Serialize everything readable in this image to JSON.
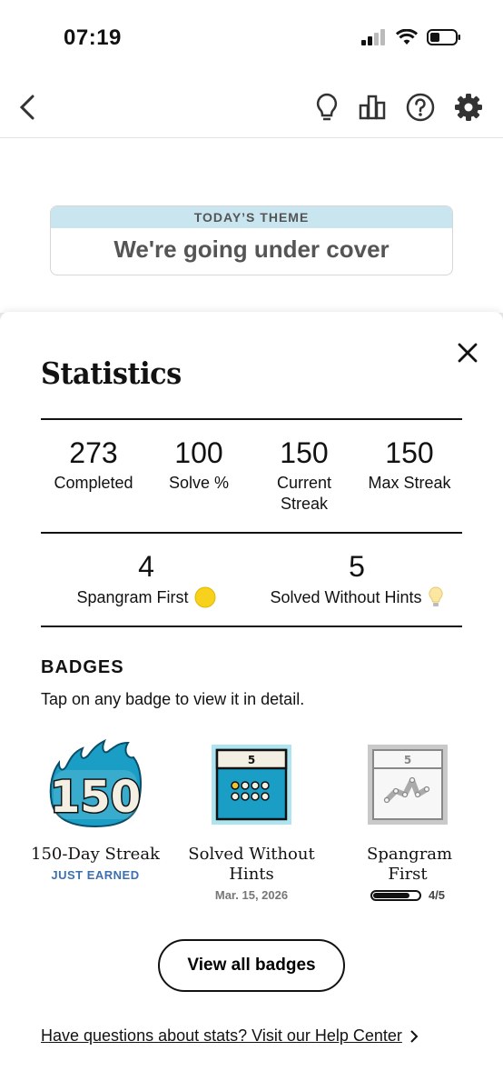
{
  "status_bar": {
    "time": "07:19"
  },
  "theme": {
    "header": "TODAY’S THEME",
    "title": "We're going under cover"
  },
  "stats": {
    "title": "Statistics",
    "row1": [
      {
        "value": "273",
        "label": "Completed"
      },
      {
        "value": "100",
        "label": "Solve %"
      },
      {
        "value": "150",
        "label": "Current Streak"
      },
      {
        "value": "150",
        "label": "Max Streak"
      }
    ],
    "row2": [
      {
        "value": "4",
        "label": "Spangram First"
      },
      {
        "value": "5",
        "label": "Solved Without Hints"
      }
    ]
  },
  "badges": {
    "heading": "BADGES",
    "subtitle": "Tap on any badge to view it in detail.",
    "items": [
      {
        "art_text": "150",
        "name": "150-Day Streak",
        "status": "JUST EARNED"
      },
      {
        "art_text": "5",
        "name": "Solved Without Hints",
        "date": "Mar. 15, 2026"
      },
      {
        "art_text": "5",
        "name": "Spangram First",
        "progress_text": "4/5",
        "progress": 0.8
      }
    ],
    "view_all": "View all badges"
  },
  "help_link": "Have questions about stats? Visit our Help Center",
  "colors": {
    "theme_header": "#c9e6f0",
    "badge_blue": "#1a9ec6",
    "earned_blue": "#3d6fb0"
  }
}
